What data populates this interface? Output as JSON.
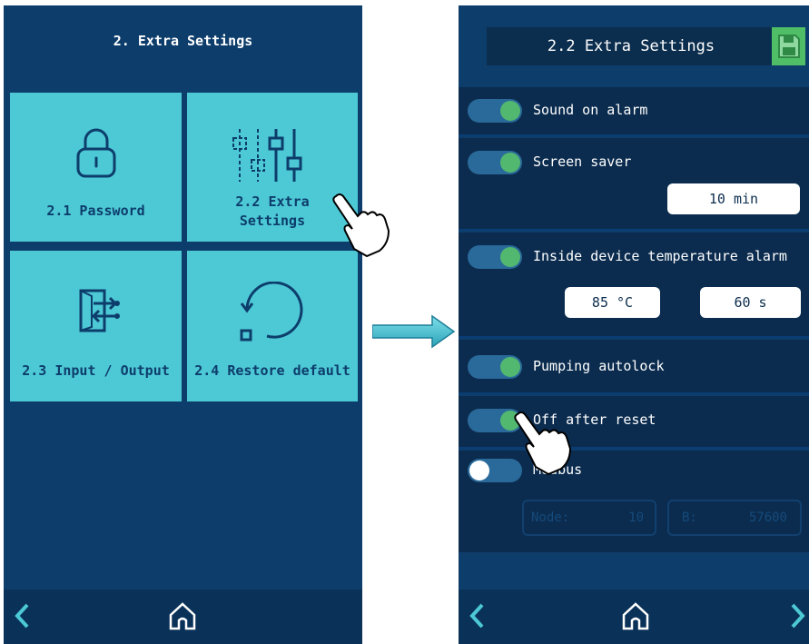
{
  "left_screen": {
    "title": "2. Extra Settings",
    "tiles": [
      {
        "label": "2.1 Password",
        "icon": "lock-icon"
      },
      {
        "label": "2.2 Extra Settings",
        "icon": "sliders-icon"
      },
      {
        "label": "2.3 Input / Output",
        "icon": "input-output-icon"
      },
      {
        "label": "2.4 Restore default",
        "icon": "restore-icon"
      }
    ],
    "tile2_line1": "2.2 Extra",
    "tile2_line2": "Settings"
  },
  "right_screen": {
    "title": "2.2 Extra Settings",
    "settings": {
      "sound_on_alarm": {
        "label": "Sound on alarm",
        "on": true
      },
      "screen_saver": {
        "label": "Screen saver",
        "on": true,
        "value": "10 min"
      },
      "inside_temp_alarm": {
        "label": "Inside device temperature alarm",
        "on": true,
        "temp": "85 °C",
        "time": "60 s"
      },
      "pumping_autolock": {
        "label": "Pumping autolock",
        "on": true
      },
      "off_after_reset": {
        "label": "Off after reset",
        "on": true
      },
      "modbus": {
        "label": "Modbus",
        "on": false,
        "node_label": "Node:",
        "node_value": "10",
        "baud_label": "B:",
        "baud_value": "57600"
      }
    }
  },
  "colors": {
    "screen_bg": "#0d3d6b",
    "tile": "#4dc9d6",
    "toggle_knob_on": "#52b86f",
    "save_button": "#4fbe66"
  }
}
